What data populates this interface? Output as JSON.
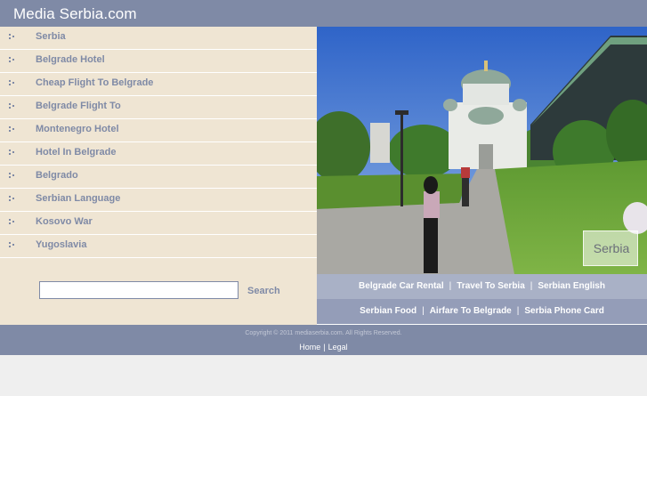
{
  "site": {
    "title": "Media Serbia.com"
  },
  "sidebar": {
    "items": [
      {
        "label": "Serbia"
      },
      {
        "label": "Belgrade Hotel"
      },
      {
        "label": "Cheap Flight To Belgrade"
      },
      {
        "label": "Belgrade Flight To"
      },
      {
        "label": "Montenegro Hotel"
      },
      {
        "label": "Hotel In Belgrade"
      },
      {
        "label": "Belgrado"
      },
      {
        "label": "Serbian Language"
      },
      {
        "label": "Kosovo War"
      },
      {
        "label": "Yugoslavia"
      }
    ]
  },
  "search": {
    "placeholder": "",
    "button_label": "Search"
  },
  "photo": {
    "caption": "Serbia"
  },
  "links": {
    "row1": [
      "Belgrade Car Rental",
      "Travel To Serbia",
      "Serbian English"
    ],
    "row2": [
      "Serbian Food",
      "Airfare To Belgrade",
      "Serbia Phone Card"
    ],
    "separator": "|"
  },
  "footer": {
    "copyright": "Copyright © 2011 mediaserbia.com. All Rights Reserved.",
    "home_label": "Home",
    "legal_label": "Legal",
    "separator": "|"
  },
  "colors": {
    "header": "#7f8aa6",
    "sidebar": "#efe5d3",
    "link_text": "#7f8aa6",
    "row1": "#a9b1c6",
    "row2": "#949db8"
  }
}
